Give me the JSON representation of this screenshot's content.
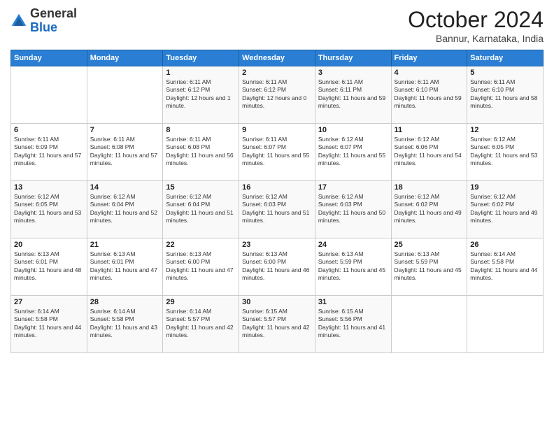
{
  "logo": {
    "general": "General",
    "blue": "Blue"
  },
  "header": {
    "title": "October 2024",
    "subtitle": "Bannur, Karnataka, India"
  },
  "days_of_week": [
    "Sunday",
    "Monday",
    "Tuesday",
    "Wednesday",
    "Thursday",
    "Friday",
    "Saturday"
  ],
  "weeks": [
    [
      {
        "day": "",
        "info": ""
      },
      {
        "day": "",
        "info": ""
      },
      {
        "day": "1",
        "info": "Sunrise: 6:11 AM\nSunset: 6:12 PM\nDaylight: 12 hours and 1 minute."
      },
      {
        "day": "2",
        "info": "Sunrise: 6:11 AM\nSunset: 6:12 PM\nDaylight: 12 hours and 0 minutes."
      },
      {
        "day": "3",
        "info": "Sunrise: 6:11 AM\nSunset: 6:11 PM\nDaylight: 11 hours and 59 minutes."
      },
      {
        "day": "4",
        "info": "Sunrise: 6:11 AM\nSunset: 6:10 PM\nDaylight: 11 hours and 59 minutes."
      },
      {
        "day": "5",
        "info": "Sunrise: 6:11 AM\nSunset: 6:10 PM\nDaylight: 11 hours and 58 minutes."
      }
    ],
    [
      {
        "day": "6",
        "info": "Sunrise: 6:11 AM\nSunset: 6:09 PM\nDaylight: 11 hours and 57 minutes."
      },
      {
        "day": "7",
        "info": "Sunrise: 6:11 AM\nSunset: 6:08 PM\nDaylight: 11 hours and 57 minutes."
      },
      {
        "day": "8",
        "info": "Sunrise: 6:11 AM\nSunset: 6:08 PM\nDaylight: 11 hours and 56 minutes."
      },
      {
        "day": "9",
        "info": "Sunrise: 6:11 AM\nSunset: 6:07 PM\nDaylight: 11 hours and 55 minutes."
      },
      {
        "day": "10",
        "info": "Sunrise: 6:12 AM\nSunset: 6:07 PM\nDaylight: 11 hours and 55 minutes."
      },
      {
        "day": "11",
        "info": "Sunrise: 6:12 AM\nSunset: 6:06 PM\nDaylight: 11 hours and 54 minutes."
      },
      {
        "day": "12",
        "info": "Sunrise: 6:12 AM\nSunset: 6:05 PM\nDaylight: 11 hours and 53 minutes."
      }
    ],
    [
      {
        "day": "13",
        "info": "Sunrise: 6:12 AM\nSunset: 6:05 PM\nDaylight: 11 hours and 53 minutes."
      },
      {
        "day": "14",
        "info": "Sunrise: 6:12 AM\nSunset: 6:04 PM\nDaylight: 11 hours and 52 minutes."
      },
      {
        "day": "15",
        "info": "Sunrise: 6:12 AM\nSunset: 6:04 PM\nDaylight: 11 hours and 51 minutes."
      },
      {
        "day": "16",
        "info": "Sunrise: 6:12 AM\nSunset: 6:03 PM\nDaylight: 11 hours and 51 minutes."
      },
      {
        "day": "17",
        "info": "Sunrise: 6:12 AM\nSunset: 6:03 PM\nDaylight: 11 hours and 50 minutes."
      },
      {
        "day": "18",
        "info": "Sunrise: 6:12 AM\nSunset: 6:02 PM\nDaylight: 11 hours and 49 minutes."
      },
      {
        "day": "19",
        "info": "Sunrise: 6:12 AM\nSunset: 6:02 PM\nDaylight: 11 hours and 49 minutes."
      }
    ],
    [
      {
        "day": "20",
        "info": "Sunrise: 6:13 AM\nSunset: 6:01 PM\nDaylight: 11 hours and 48 minutes."
      },
      {
        "day": "21",
        "info": "Sunrise: 6:13 AM\nSunset: 6:01 PM\nDaylight: 11 hours and 47 minutes."
      },
      {
        "day": "22",
        "info": "Sunrise: 6:13 AM\nSunset: 6:00 PM\nDaylight: 11 hours and 47 minutes."
      },
      {
        "day": "23",
        "info": "Sunrise: 6:13 AM\nSunset: 6:00 PM\nDaylight: 11 hours and 46 minutes."
      },
      {
        "day": "24",
        "info": "Sunrise: 6:13 AM\nSunset: 5:59 PM\nDaylight: 11 hours and 45 minutes."
      },
      {
        "day": "25",
        "info": "Sunrise: 6:13 AM\nSunset: 5:59 PM\nDaylight: 11 hours and 45 minutes."
      },
      {
        "day": "26",
        "info": "Sunrise: 6:14 AM\nSunset: 5:58 PM\nDaylight: 11 hours and 44 minutes."
      }
    ],
    [
      {
        "day": "27",
        "info": "Sunrise: 6:14 AM\nSunset: 5:58 PM\nDaylight: 11 hours and 44 minutes."
      },
      {
        "day": "28",
        "info": "Sunrise: 6:14 AM\nSunset: 5:58 PM\nDaylight: 11 hours and 43 minutes."
      },
      {
        "day": "29",
        "info": "Sunrise: 6:14 AM\nSunset: 5:57 PM\nDaylight: 11 hours and 42 minutes."
      },
      {
        "day": "30",
        "info": "Sunrise: 6:15 AM\nSunset: 5:57 PM\nDaylight: 11 hours and 42 minutes."
      },
      {
        "day": "31",
        "info": "Sunrise: 6:15 AM\nSunset: 5:56 PM\nDaylight: 11 hours and 41 minutes."
      },
      {
        "day": "",
        "info": ""
      },
      {
        "day": "",
        "info": ""
      }
    ]
  ]
}
